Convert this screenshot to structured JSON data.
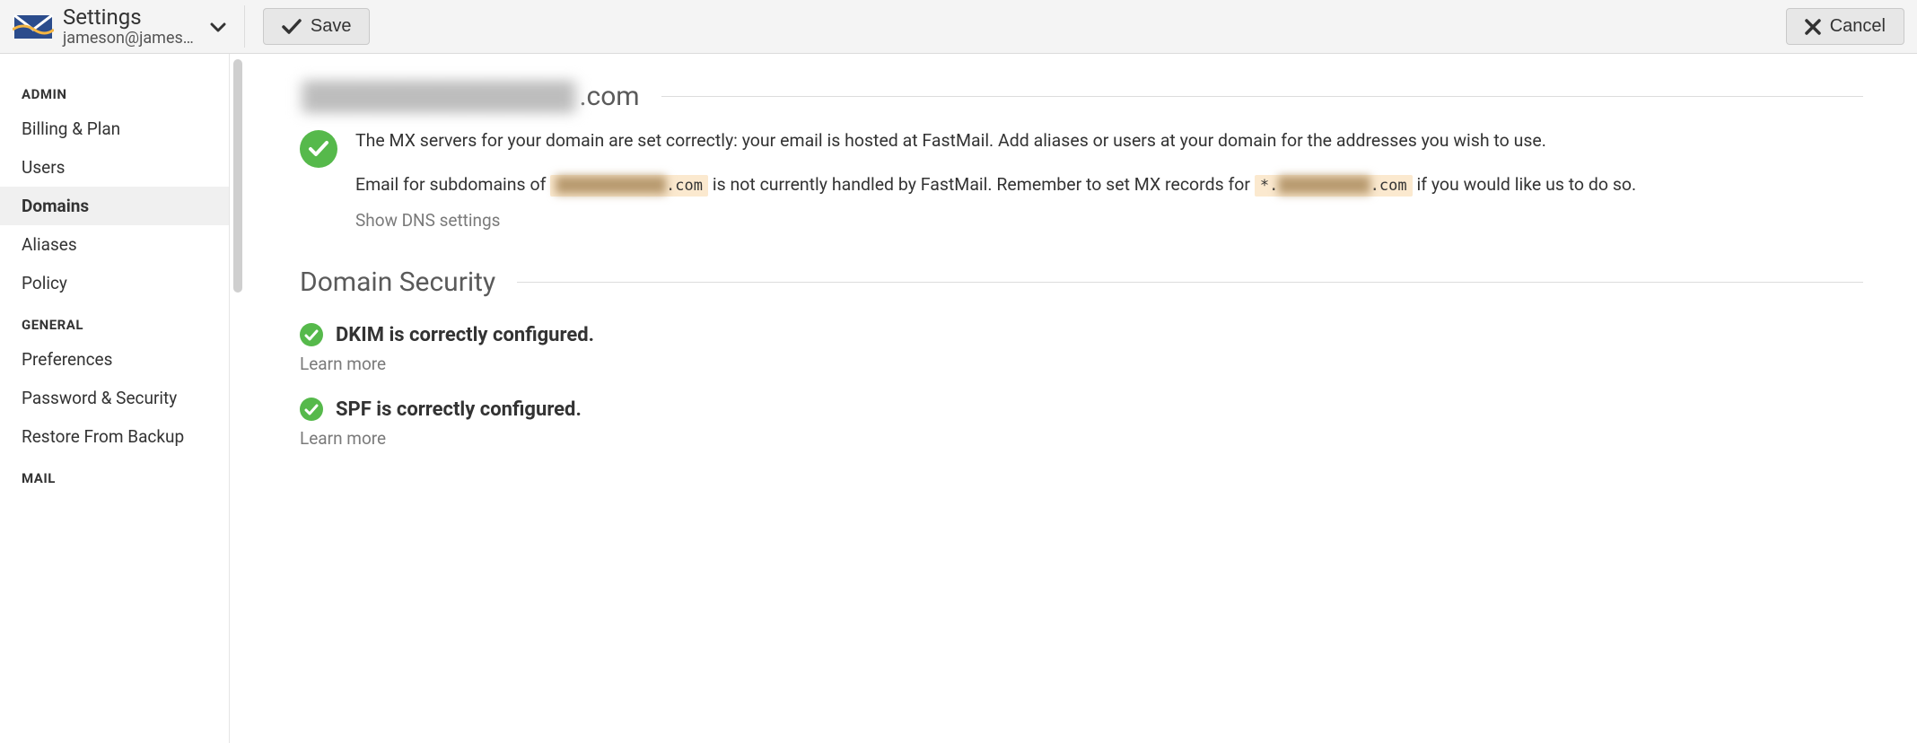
{
  "header": {
    "title": "Settings",
    "subtitle": "jameson@james…",
    "save_label": "Save",
    "cancel_label": "Cancel"
  },
  "sidebar": {
    "sections": [
      {
        "title": "ADMIN",
        "items": [
          {
            "label": "Billing & Plan",
            "active": false
          },
          {
            "label": "Users",
            "active": false
          },
          {
            "label": "Domains",
            "active": true
          },
          {
            "label": "Aliases",
            "active": false
          },
          {
            "label": "Policy",
            "active": false
          }
        ]
      },
      {
        "title": "GENERAL",
        "items": [
          {
            "label": "Preferences",
            "active": false
          },
          {
            "label": "Password & Security",
            "active": false
          },
          {
            "label": "Restore From Backup",
            "active": false
          }
        ]
      },
      {
        "title": "MAIL",
        "items": []
      }
    ]
  },
  "main": {
    "domain_redacted_prefix": "██████████████",
    "domain_suffix": ".com",
    "mx_status_text": "The MX servers for your domain are set correctly: your email is hosted at FastMail. Add aliases or users at your domain for the addresses you wish to use.",
    "sub_pre": "Email for subdomains of ",
    "sub_chip1_blur": "████████████",
    "sub_chip1_suffix": ".com",
    "sub_mid": " is not currently handled by FastMail. Remember to set MX records for ",
    "sub_chip2_prefix": "*.",
    "sub_chip2_blur": "██████████",
    "sub_chip2_suffix": ".com",
    "sub_post": " if you would like us to do so.",
    "show_dns_label": "Show DNS settings",
    "security_title": "Domain Security",
    "dkim_msg": "DKIM is correctly configured.",
    "spf_msg": "SPF is correctly configured.",
    "learn_more_label": "Learn more"
  }
}
